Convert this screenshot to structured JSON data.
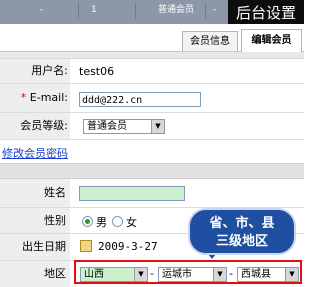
{
  "topbar": {
    "item_dash1": "-",
    "item_num": "1",
    "item_type": "普通会员",
    "item_dash2": "-"
  },
  "corner_title": "后台设置",
  "tabs": [
    {
      "label": "会员信息"
    },
    {
      "label": "编辑会员"
    }
  ],
  "form": {
    "username_label": "用户名:",
    "username_value": "test06",
    "email_required_mark": "*",
    "email_label": " E-mail:",
    "email_value": "ddd@222.cn",
    "level_label": "会员等级:",
    "level_value": "普通会员",
    "change_password_link": "修改会员密码"
  },
  "profile": {
    "name_label": "姓名",
    "name_value": "",
    "gender_label": "性别",
    "gender_options": [
      {
        "label": "男",
        "selected": true
      },
      {
        "label": "女",
        "selected": false
      }
    ],
    "birthday_label": "出生日期",
    "birthday_value": "2009-3-27",
    "region_label": "地区",
    "province": "山西",
    "city": "运城市",
    "district": "西城县",
    "sep": "-"
  },
  "callout": {
    "line1": "省、市、县",
    "line2": "三级地区"
  },
  "colors": {
    "highlight_red": "#e01010",
    "callout_blue": "#1f4fa0",
    "input_green": "#ccf0cc"
  }
}
